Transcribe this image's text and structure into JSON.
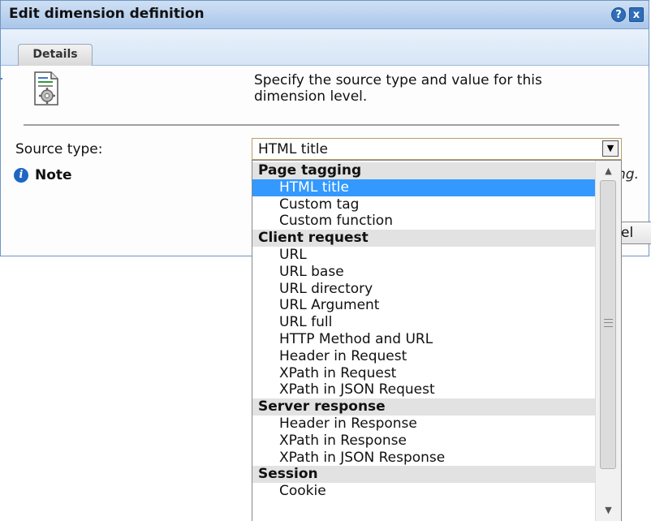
{
  "dialog": {
    "title": "Edit dimension definition",
    "help_glyph": "?",
    "close_glyph": "x"
  },
  "tabs": [
    {
      "label": "Details",
      "active": true
    }
  ],
  "icon": {
    "name": "dimension-document-gear-icon"
  },
  "intro_text": "Specify the source type and value for this dimension level.",
  "form": {
    "source_type_label": "Source type:",
    "selected_value": "HTML title",
    "note_label": "Note",
    "peek_text": "ng.",
    "cancel_fragment": "el"
  },
  "dropdown": {
    "items": [
      {
        "type": "group",
        "label": "Page tagging"
      },
      {
        "type": "option",
        "label": "HTML title",
        "selected": true
      },
      {
        "type": "option",
        "label": "Custom tag"
      },
      {
        "type": "option",
        "label": "Custom function"
      },
      {
        "type": "group",
        "label": "Client request"
      },
      {
        "type": "option",
        "label": "URL"
      },
      {
        "type": "option",
        "label": "URL base"
      },
      {
        "type": "option",
        "label": "URL directory"
      },
      {
        "type": "option",
        "label": "URL Argument"
      },
      {
        "type": "option",
        "label": "URL full"
      },
      {
        "type": "option",
        "label": "HTTP Method and URL"
      },
      {
        "type": "option",
        "label": "Header in Request"
      },
      {
        "type": "option",
        "label": "XPath in Request"
      },
      {
        "type": "option",
        "label": "XPath in JSON Request"
      },
      {
        "type": "group",
        "label": "Server response"
      },
      {
        "type": "option",
        "label": "Header in Response"
      },
      {
        "type": "option",
        "label": "XPath in Response"
      },
      {
        "type": "option",
        "label": "XPath in JSON Response"
      },
      {
        "type": "group",
        "label": "Session"
      },
      {
        "type": "option",
        "label": "Cookie"
      }
    ]
  },
  "colors": {
    "title_bar": "#a9c6ea",
    "selection": "#3399ff",
    "group_header": "#e2e2e2",
    "info_icon": "#1e66c4"
  }
}
